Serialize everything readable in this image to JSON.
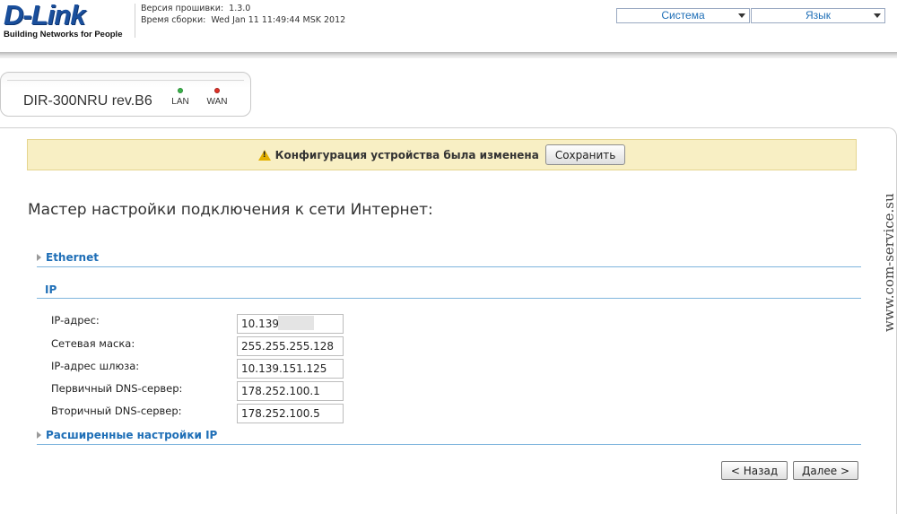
{
  "header": {
    "logo": {
      "brand": "D-Link",
      "tagline": "Building Networks for People"
    },
    "firmware": {
      "version_label": "Версия прошивки:",
      "version_value": "1.3.0",
      "build_label": "Время сборки:",
      "build_value": "Wed Jan 11 11:49:44 MSK 2012"
    },
    "menus": [
      {
        "label": "Система"
      },
      {
        "label": "Язык"
      }
    ]
  },
  "device": {
    "name": "DIR-300NRU rev.B6",
    "leds": [
      {
        "label": "LAN",
        "color": "#39b54a"
      },
      {
        "label": "WAN",
        "color": "#e03127"
      }
    ]
  },
  "notice": {
    "text": "Конфигурация устройства была изменена",
    "save_label": "Сохранить",
    "bg_color": "#f8efc4"
  },
  "wizard": {
    "title": "Мастер настройки подключения к сети Интернет:",
    "sections": {
      "ethernet": "Ethernet",
      "ip": "IP",
      "advanced_ip": "Расширенные настройки IP"
    },
    "fields": [
      {
        "label": "IP-адрес:",
        "value": "10.139."
      },
      {
        "label": "Сетевая маска:",
        "value": "255.255.255.128"
      },
      {
        "label": "IP-адрес шлюза:",
        "value": "10.139.151.125"
      },
      {
        "label": "Первичный DNS-сервер:",
        "value": "178.252.100.1"
      },
      {
        "label": "Вторичный DNS-сервер:",
        "value": "178.252.100.5"
      }
    ],
    "buttons": {
      "back": "< Назад",
      "next": "Далее >"
    }
  },
  "watermark": "www.com-service.su",
  "colors": {
    "accent": "#1f6fb7",
    "rule": "#7fb5dd"
  }
}
